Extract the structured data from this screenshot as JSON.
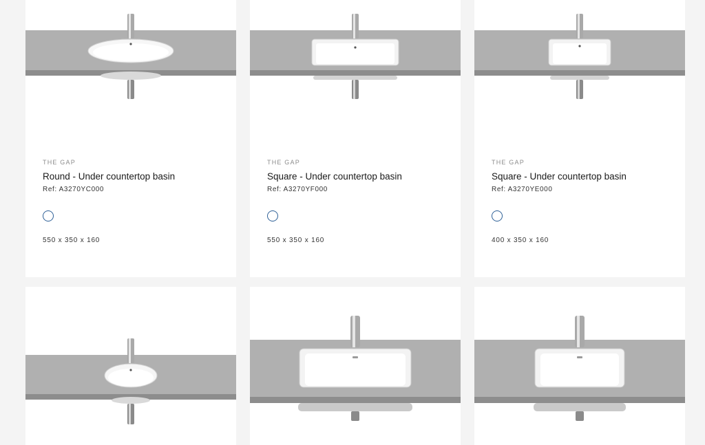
{
  "products": [
    {
      "collection": "THE GAP",
      "title": "Round - Under countertop basin",
      "ref": "Ref: A3270YC000",
      "dimensions": "550 x 350 x 160",
      "finish_color": "#ffffff"
    },
    {
      "collection": "THE GAP",
      "title": "Square - Under countertop basin",
      "ref": "Ref: A3270YF000",
      "dimensions": "550 x 350 x 160",
      "finish_color": "#ffffff"
    },
    {
      "collection": "THE GAP",
      "title": "Square - Under countertop basin",
      "ref": "Ref: A3270YE000",
      "dimensions": "400 x 350 x 160",
      "finish_color": "#ffffff"
    }
  ],
  "colors": {
    "countertop": "#b2b2b2",
    "basin": "#ffffff",
    "swatch_border": "#2d5f96",
    "background": "#f4f4f4"
  }
}
